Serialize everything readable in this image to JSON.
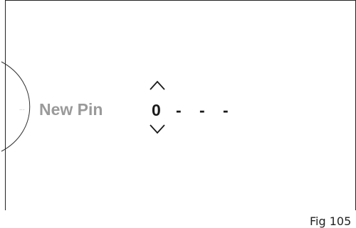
{
  "menu": {
    "more_indicator": "...",
    "title": "New Pin"
  },
  "pin_entry": {
    "digits": [
      "0",
      "-",
      "-",
      "-"
    ],
    "active_index": 0
  },
  "figure": {
    "label": "Fig 105"
  },
  "icons": {
    "up": "chevron-up-icon",
    "down": "chevron-down-icon"
  }
}
